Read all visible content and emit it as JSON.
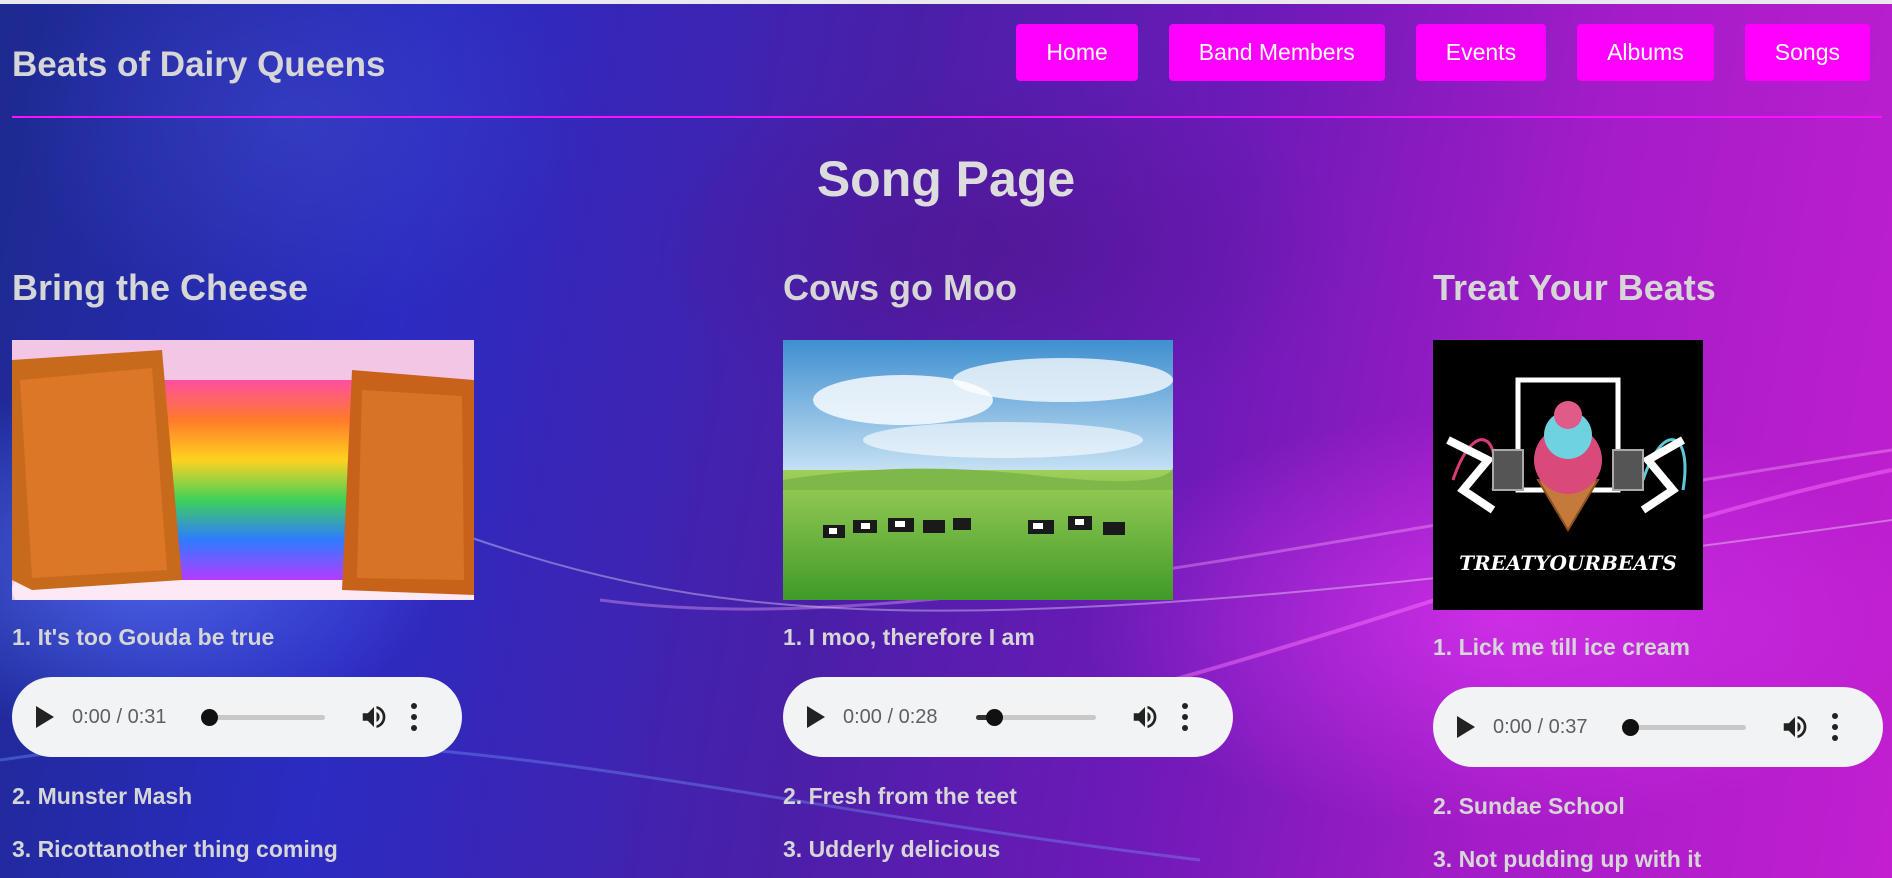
{
  "site": {
    "title": "Beats of Dairy Queens"
  },
  "nav": {
    "items": [
      {
        "label": "Home"
      },
      {
        "label": "Band Members"
      },
      {
        "label": "Events"
      },
      {
        "label": "Albums"
      },
      {
        "label": "Songs"
      }
    ]
  },
  "page": {
    "title": "Song Page"
  },
  "albums": [
    {
      "title": "Bring the Cheese",
      "cover_alt": "rainbow grilled cheese sandwich",
      "tracks": [
        "1. It's too Gouda be true",
        "2. Munster Mash",
        "3. Ricottanother thing coming"
      ],
      "player": {
        "time": "0:00 / 0:31",
        "progress": 0.0
      }
    },
    {
      "title": "Cows go Moo",
      "cover_alt": "cows on a green pasture",
      "tracks": [
        "1. I moo, therefore I am",
        "2. Fresh from the teet",
        "3. Udderly delicious"
      ],
      "player": {
        "time": "0:00 / 0:28",
        "progress": 0.12
      }
    },
    {
      "title": "Treat Your Beats",
      "cover_alt": "ice cream cone logo",
      "cover_text": "TREATYOURBEATS",
      "tracks": [
        "1. Lick me till ice cream",
        "2. Sundae School",
        "3. Not pudding up with it"
      ],
      "player": {
        "time": "0:00 / 0:37",
        "progress": 0.0
      }
    }
  ],
  "colors": {
    "accent": "#ff00ff",
    "player_bg": "#f1f3f4",
    "heading": "#d6d6d6"
  }
}
